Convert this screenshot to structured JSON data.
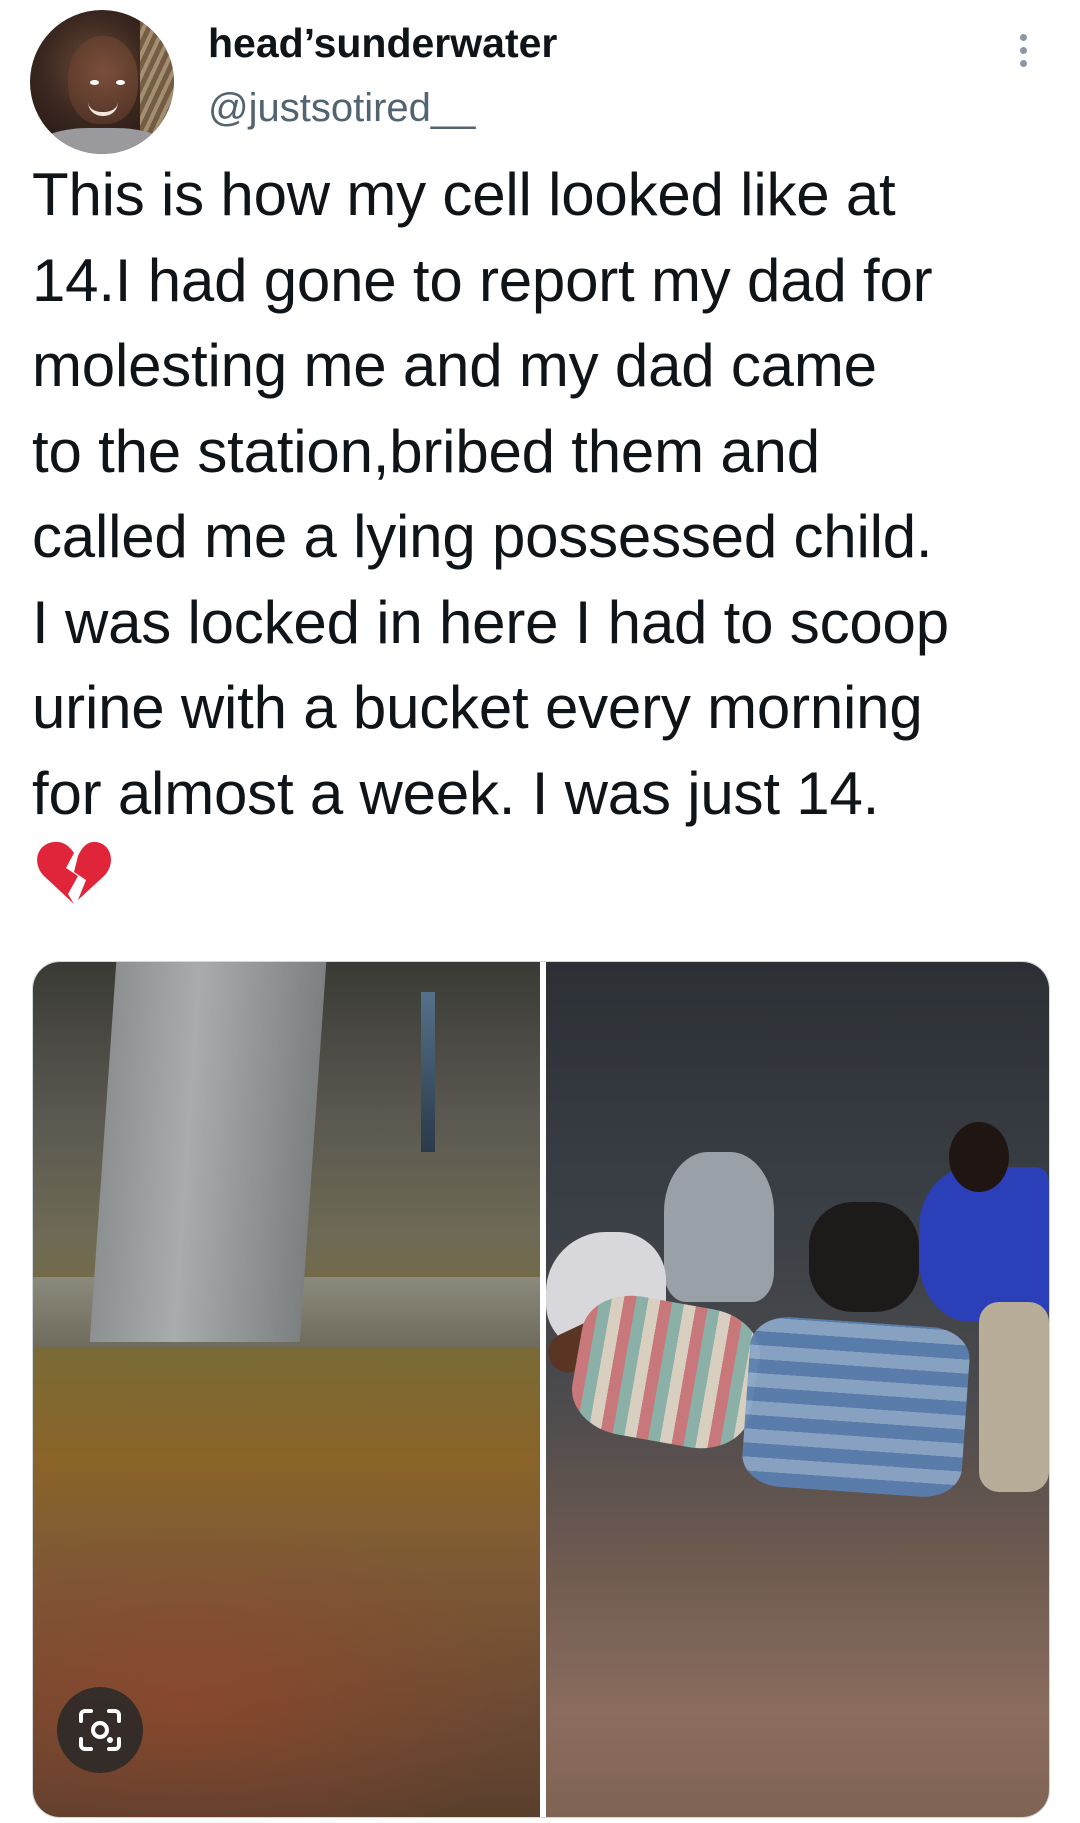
{
  "author": {
    "display_name": "head’sunderwater",
    "handle": "@justsotired__"
  },
  "tweet": {
    "text": "This is how my cell looked like at\n14.I had gone to report my dad for\nmolesting me and my dad came\nto the station,bribed them and\ncalled me a lying possessed child.\nI was locked in here I had to scoop\nurine with a bucket every morning\nfor almost a week. I was just 14.",
    "emoji_icon": "broken-heart-icon"
  },
  "media": {
    "count": 2,
    "lens_icon": "visual-search-icon"
  },
  "colors": {
    "text": "#0f1419",
    "secondary_text": "#536471",
    "heart": "#e0243a",
    "border": "#cfd9de"
  }
}
